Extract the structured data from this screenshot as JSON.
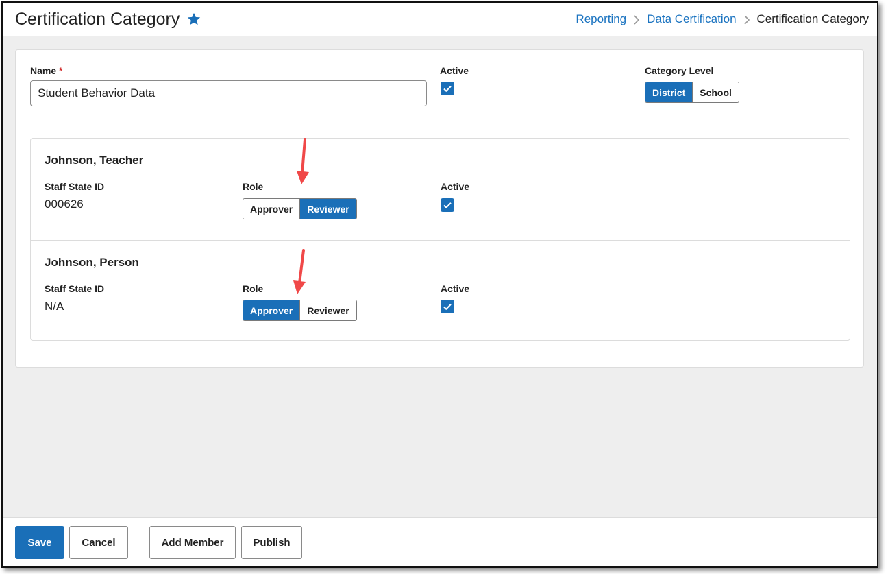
{
  "header": {
    "title": "Certification Category",
    "breadcrumb": [
      {
        "label": "Reporting"
      },
      {
        "label": "Data Certification"
      },
      {
        "label": "Certification Category"
      }
    ]
  },
  "form": {
    "name_label": "Name",
    "required_mark": "*",
    "name_value": "Student Behavior Data",
    "active_label": "Active",
    "active_checked": true,
    "category_level_label": "Category Level",
    "category_level_options": [
      "District",
      "School"
    ],
    "category_level_selected": "District"
  },
  "members": [
    {
      "name": "Johnson, Teacher",
      "staff_state_id_label": "Staff State ID",
      "staff_state_id": "000626",
      "role_label": "Role",
      "role_options": [
        "Approver",
        "Reviewer"
      ],
      "role_selected": "Reviewer",
      "active_label": "Active",
      "active_checked": true
    },
    {
      "name": "Johnson, Person",
      "staff_state_id_label": "Staff State ID",
      "staff_state_id": "N/A",
      "role_label": "Role",
      "role_options": [
        "Approver",
        "Reviewer"
      ],
      "role_selected": "Approver",
      "active_label": "Active",
      "active_checked": true
    }
  ],
  "footer": {
    "save_label": "Save",
    "cancel_label": "Cancel",
    "add_member_label": "Add Member",
    "publish_label": "Publish"
  },
  "colors": {
    "accent": "#1a6fb8",
    "link": "#1a73c0",
    "required": "#d32f2f",
    "annotation_arrow": "#f04848"
  },
  "icons": [
    "star-icon",
    "chevron-right-icon",
    "checkmark-icon",
    "annotation-arrow"
  ]
}
